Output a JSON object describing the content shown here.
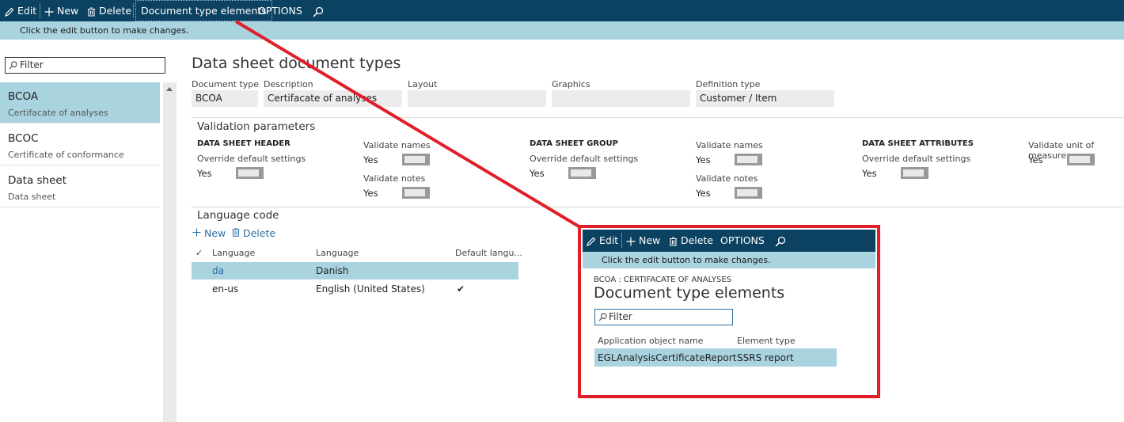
{
  "actionbar": {
    "edit": "Edit",
    "new": "New",
    "delete": "Delete",
    "doc_type_elements": "Document type elements",
    "options": "OPTIONS",
    "search_icon": "search-icon"
  },
  "message": "Click the edit button to make changes.",
  "left": {
    "filter_placeholder": "Filter",
    "items": [
      {
        "title": "BCOA",
        "subtitle": "Certifacate of analyses",
        "selected": true
      },
      {
        "title": "BCOC",
        "subtitle": "Certificate of conformance",
        "selected": false
      },
      {
        "title": "Data sheet",
        "subtitle": "Data sheet",
        "selected": false
      }
    ]
  },
  "main": {
    "title": "Data sheet document types",
    "fields": {
      "document_type": {
        "label": "Document type",
        "value": "BCOA"
      },
      "description": {
        "label": "Description",
        "value": "Certifacate of analyses"
      },
      "layout": {
        "label": "Layout",
        "value": ""
      },
      "graphics": {
        "label": "Graphics",
        "value": ""
      },
      "definition_type": {
        "label": "Definition type",
        "value": "Customer / Item"
      }
    },
    "validation": {
      "title": "Validation parameters",
      "header_group": "DATA SHEET HEADER",
      "group_group": "DATA SHEET GROUP",
      "attributes_group": "DATA SHEET ATTRIBUTES",
      "override_label": "Override default settings",
      "validate_names": "Validate names",
      "validate_notes": "Validate notes",
      "validate_uom": "Validate unit of measure",
      "yes": "Yes"
    },
    "language": {
      "title": "Language code",
      "new": "New",
      "delete": "Delete",
      "columns": [
        "Language",
        "Language",
        "Default langu..."
      ],
      "rows": [
        {
          "code": "da",
          "name": "Danish",
          "default": "",
          "selected": true
        },
        {
          "code": "en-us",
          "name": "English (United States)",
          "default": "✔",
          "selected": false
        }
      ]
    }
  },
  "popup": {
    "edit": "Edit",
    "new": "New",
    "delete": "Delete",
    "options": "OPTIONS",
    "message": "Click the edit button to make changes.",
    "caption": "BCOA : CERTIFACATE OF ANALYSES",
    "title": "Document type elements",
    "filter_placeholder": "Filter",
    "columns": [
      "Application object name",
      "Element type"
    ],
    "rows": [
      {
        "name": "EGLAnalysisCertificateReport",
        "type": "SSRS report"
      }
    ]
  },
  "colors": {
    "actionbar": "#0b4262",
    "selection": "#a9d3df",
    "annotation": "#e02028",
    "link": "#2b6fa1"
  }
}
